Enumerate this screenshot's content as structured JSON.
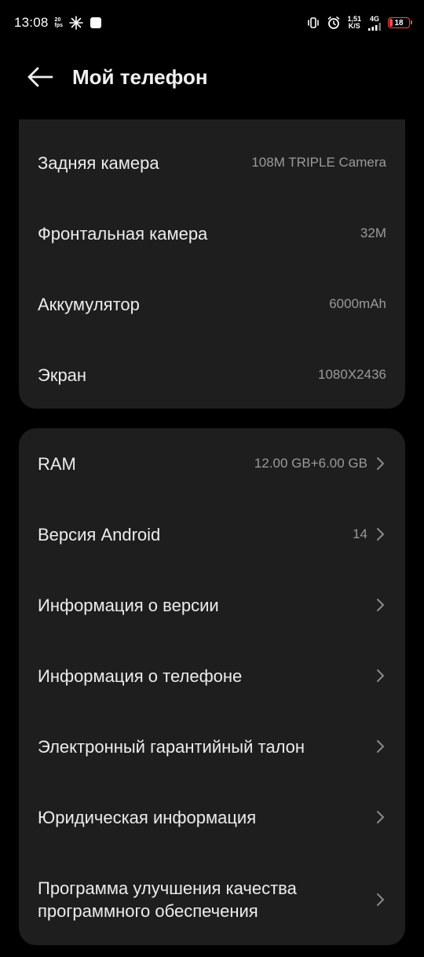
{
  "status_bar": {
    "time": "13:08",
    "mini_speed_top": "20",
    "mini_speed_bottom": "fps",
    "net_speed_value": "1,51",
    "net_speed_unit": "K/S",
    "network_type": "4G",
    "battery_level": "18",
    "battery_fraction": 0.18,
    "battery_color": "#ff4a4a"
  },
  "header": {
    "title": "Мой телефон"
  },
  "specs": [
    {
      "label": "Задняя камера",
      "value": "108M TRIPLE Camera"
    },
    {
      "label": "Фронтальная камера",
      "value": "32M"
    },
    {
      "label": "Аккумулятор",
      "value": "6000mAh"
    },
    {
      "label": "Экран",
      "value": "1080X2436"
    }
  ],
  "menu": [
    {
      "label": "RAM",
      "value": "12.00 GB+6.00 GB"
    },
    {
      "label": "Версия Android",
      "value": "14"
    },
    {
      "label": "Информация о версии",
      "value": ""
    },
    {
      "label": "Информация о телефоне",
      "value": ""
    },
    {
      "label": "Электронный гарантийный талон",
      "value": ""
    },
    {
      "label": "Юридическая информация",
      "value": ""
    },
    {
      "label": "Программа улучшения качества программного обеспечения",
      "value": ""
    }
  ],
  "colors": {
    "background": "#000000",
    "card": "#1e1e1e",
    "primary_text": "#ececec",
    "secondary_text": "#9a9a9a"
  },
  "icons": [
    "back-arrow-icon",
    "bluetooth-icon",
    "vibrate-icon",
    "alarm-icon",
    "signal-icon",
    "chevron-right-icon"
  ]
}
